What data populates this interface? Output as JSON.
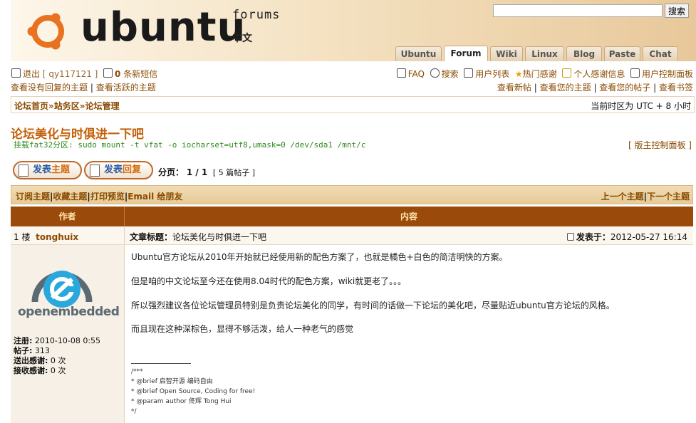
{
  "header": {
    "brand": "ubuntu",
    "brand_sub": "forums",
    "brand_cn": "中文",
    "search_placeholder": "",
    "search_button": "搜索",
    "tabs": [
      {
        "label": "Ubuntu",
        "active": false
      },
      {
        "label": "Forum",
        "active": true
      },
      {
        "label": "Wiki",
        "active": false
      },
      {
        "label": "Linux",
        "active": false
      },
      {
        "label": "Blog",
        "active": false
      },
      {
        "label": "Paste",
        "active": false
      },
      {
        "label": "Chat",
        "active": false
      }
    ]
  },
  "userbar": {
    "logout": "退出",
    "username": "[ qy117121 ]",
    "pm_count": "0",
    "pm_label": "条新短信",
    "unanswered": "查看没有回复的主题",
    "active": "查看活跃的主题",
    "right_links": [
      "FAQ",
      "搜索",
      "用户列表",
      "热门感谢",
      "个人感谢信息",
      "用户控制面板"
    ],
    "right_links2": [
      "查看新帖",
      "查看您的主题",
      "查看您的帖子",
      "查看书签"
    ]
  },
  "breadcrumb": {
    "items": [
      "论坛首页",
      "站务区",
      "论坛管理"
    ],
    "sep": "»",
    "timezone": "当前时区为 UTC + 8 小时"
  },
  "topic": {
    "title": "论坛美化与时俱进一下吧",
    "description": "挂载fat32分区: sudo mount -t vfat -o iocharset=utf8,umask=0 /dev/sda1 /mnt/c",
    "mod_panel": "[ 版主控制面板 ]",
    "btn_new_a": "发表",
    "btn_new_b": "主题",
    "btn_reply_a": "发表",
    "btn_reply_b": "回复",
    "page_label": "分页：",
    "page_value": "1 / 1",
    "post_count": "[ 5 篇帖子 ]"
  },
  "tools": {
    "left": [
      "订阅主题",
      "收藏主题",
      "打印预览",
      "Email 给朋友"
    ],
    "right": [
      "上一个主题",
      "下一个主题"
    ]
  },
  "table": {
    "col_author": "作者",
    "col_content": "内容"
  },
  "post": {
    "floor": "1 楼",
    "author": "tonghuix",
    "subject_label": "文章标题：",
    "subject": "论坛美化与时俱进一下吧",
    "posted_label": "发表于：",
    "posted": "2012-05-27 16:14",
    "avatar_text": "openembedded",
    "stats": [
      {
        "label": "注册:",
        "value": "2010-10-08 0:55"
      },
      {
        "label": "帖子:",
        "value": "313"
      },
      {
        "label": "送出感谢:",
        "value": "0 次"
      },
      {
        "label": "接收感谢:",
        "value": "0 次"
      }
    ],
    "paragraphs": [
      "Ubuntu官方论坛从2010年开始就已经使用新的配色方案了，也就是橘色+白色的简洁明快的方案。",
      "但是咱的中文论坛至今还在使用8.04时代的配色方案，wiki就更老了。。。",
      "所以强烈建议各位论坛管理员特别是负责论坛美化的同学，有时间的话做一下论坛的美化吧，尽量贴近ubuntu官方论坛的风格。",
      "而且现在这种深棕色，显得不够活泼，给人一种老气的感觉"
    ],
    "signature": [
      "/***",
      "* @brief 启智开源 编码自由",
      "* @brief Open Source, Coding for free!",
      "* @param author 佟辉 Tong Hui",
      "*/"
    ]
  },
  "colors": {
    "accent": "#c4610a",
    "header_dark": "#9a4a0a",
    "link": "#8a4a00"
  }
}
